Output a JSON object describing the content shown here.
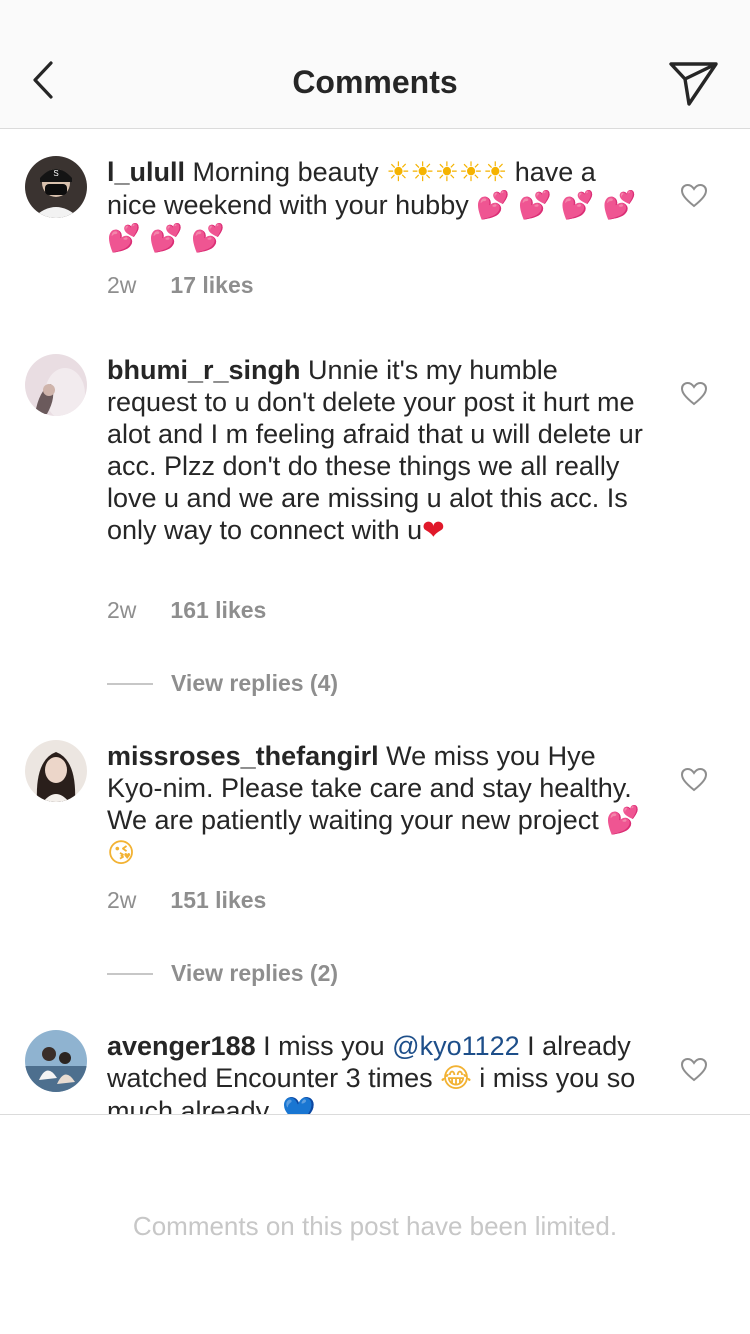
{
  "header": {
    "title": "Comments",
    "back_icon": "chevron-left-icon",
    "send_icon": "paper-plane-icon"
  },
  "comments": [
    {
      "username": "l_ulull",
      "text_a": "Morning beauty ",
      "emoji_a": "☀☀☀☀☀",
      "text_b": " have a nice weekend with your hubby ",
      "emoji_b": "💕 💕 💕 💕 💕 💕 💕",
      "age": "2w",
      "likes": "17 likes"
    },
    {
      "username": "bhumi_r_singh",
      "text_a": "Unnie it's my humble request to u don't delete your post it hurt me alot and I m feeling afraid that u will delete ur acc. Plzz don't do these things we all really love u and we are missing u alot this acc. Is only way to connect with u",
      "emoji_a": "❤",
      "age": "2w",
      "likes": "161 likes",
      "view_replies": "View replies (4)"
    },
    {
      "username": "missroses_thefangirl",
      "text_a": "We miss you Hye Kyo-nim. Please take care and stay healthy. We are patiently waiting your new project ",
      "emoji_a": "💕",
      "emoji_b": "😘",
      "age": "2w",
      "likes": "151 likes",
      "view_replies": "View replies (2)"
    },
    {
      "username": "avenger188",
      "text_a": "I miss you ",
      "mention": "@kyo1122",
      "text_b": " I already watched Encounter 3 times ",
      "emoji_a": "😂",
      "text_c": " i miss you so much already. ",
      "emoji_b": "💙"
    }
  ],
  "footer": {
    "limited_text": "Comments on this post have been limited."
  },
  "colors": {
    "header_bg": "#fafafa",
    "text": "#262626",
    "secondary": "#8e8e8e",
    "mention": "#1d4e89",
    "divider": "#dbdbdb"
  }
}
